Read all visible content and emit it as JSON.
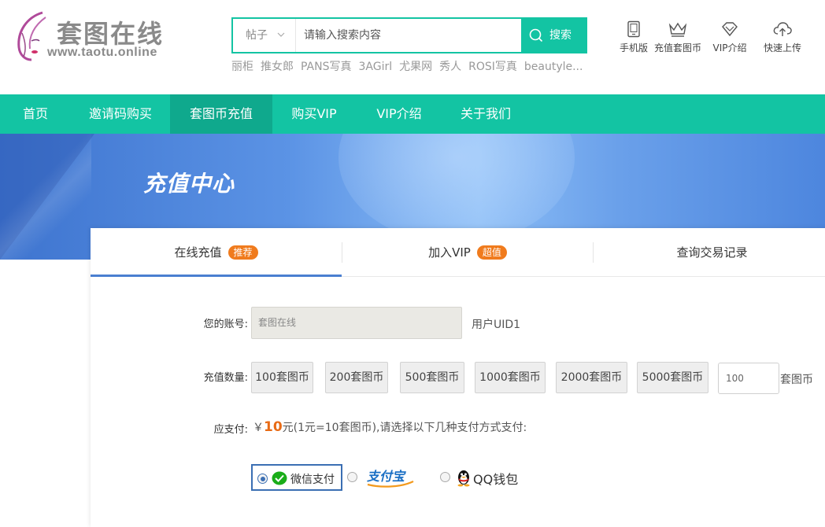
{
  "brand": {
    "name": "套图在线",
    "url": "www.taotu.online"
  },
  "search": {
    "category": "帖子",
    "placeholder": "请输入搜索内容",
    "button_label": "搜索",
    "hot_tags": [
      "丽柜",
      "推女郎",
      "PANS写真",
      "3AGirl",
      "尤果网",
      "秀人",
      "ROSI写真",
      "beautyle..."
    ]
  },
  "quick_links": [
    {
      "label": "手机版",
      "icon": "tablet-icon"
    },
    {
      "label": "充值套图币",
      "icon": "crown-icon"
    },
    {
      "label": "VIP介绍",
      "icon": "diamond-icon"
    },
    {
      "label": "快速上传",
      "icon": "cloud-upload-icon"
    }
  ],
  "nav": [
    {
      "label": "首页",
      "active": false
    },
    {
      "label": "邀请码购买",
      "active": false
    },
    {
      "label": "套图币充值",
      "active": true
    },
    {
      "label": "购买VIP",
      "active": false
    },
    {
      "label": "VIP介绍",
      "active": false
    },
    {
      "label": "关于我们",
      "active": false
    }
  ],
  "banner": {
    "title": "充值中心"
  },
  "tabs": [
    {
      "label": "在线充值",
      "badge": "推荐",
      "active": true
    },
    {
      "label": "加入VIP",
      "badge": "超值",
      "active": false
    },
    {
      "label": "查询交易记录",
      "badge": "",
      "active": false
    }
  ],
  "form": {
    "account_label": "您的账号:",
    "account_value": "套图在线",
    "uid_text": "用户UID1",
    "amount_label": "充值数量:",
    "amount_options": [
      "100套图币",
      "200套图币",
      "500套图币",
      "1000套图币",
      "2000套图币",
      "5000套图币"
    ],
    "custom_amount": "100",
    "custom_unit": "套图币",
    "pay_label": "应支付:",
    "currency_symbol": "￥",
    "pay_amount": "10",
    "pay_note": "元(1元=10套图币),请选择以下几种支付方式支付:"
  },
  "payment_methods": [
    {
      "label": "微信支付",
      "icon": "wechat-icon",
      "selected": true
    },
    {
      "label": "支付宝",
      "icon": "alipay-logo",
      "selected": false
    },
    {
      "label": "QQ钱包",
      "icon": "qq-penguin-icon",
      "selected": false
    }
  ],
  "colors": {
    "primary": "#13c4a3",
    "nav_active": "#0fa98d",
    "badge": "#f07b1d",
    "amount": "#e86b16",
    "tab_underline": "#4a7fd0"
  }
}
